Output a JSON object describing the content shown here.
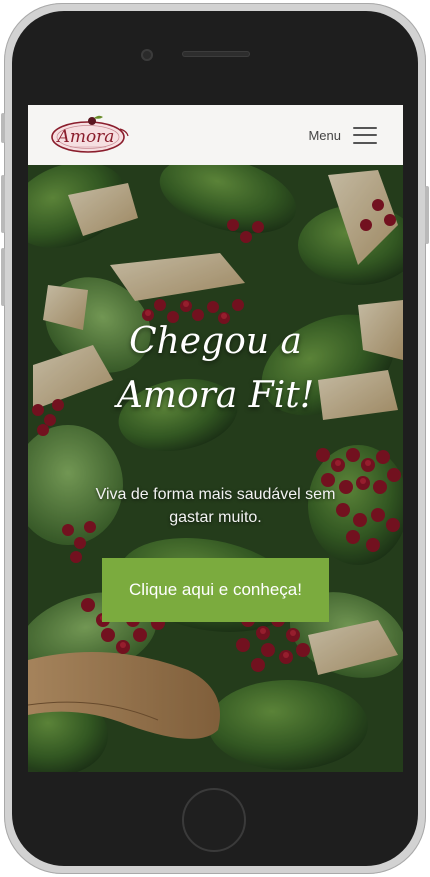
{
  "header": {
    "logo_text": "Amora",
    "menu_label": "Menu"
  },
  "hero": {
    "title_line1": "Chegou a",
    "title_line2": "Amora Fit!",
    "subtitle": "Viva de forma mais saudável sem gastar muito.",
    "cta_label": "Clique aqui e conheça!"
  },
  "carousel": {
    "slide_count": 2,
    "active_slide": 1
  },
  "colors": {
    "cta_background": "#7bab3e",
    "header_background": "#f6f5f3",
    "logo_color": "#8a1d2c"
  },
  "icons": {
    "menu": "hamburger-icon",
    "logo": "amora-logo"
  }
}
